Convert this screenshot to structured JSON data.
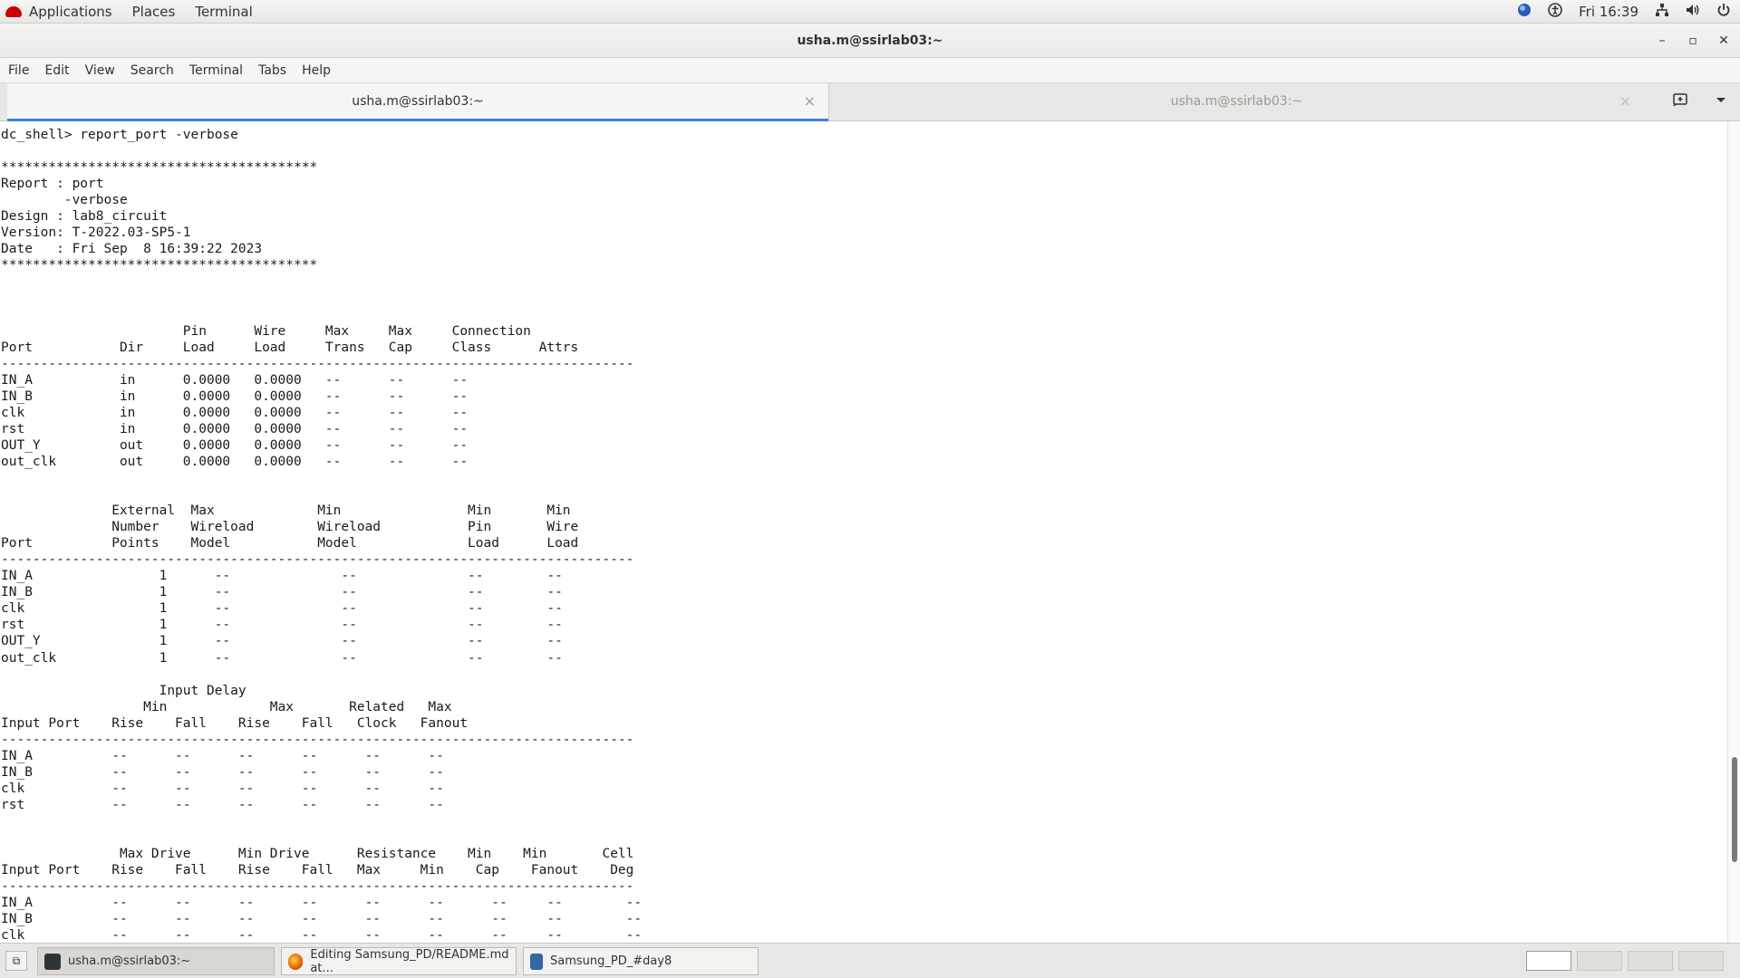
{
  "topbar": {
    "applications": "Applications",
    "places": "Places",
    "terminal": "Terminal",
    "clock": "Fri 16:39",
    "status_icons": [
      "globe-icon",
      "accessibility-icon",
      "network-icon",
      "volume-icon",
      "power-icon"
    ]
  },
  "window": {
    "title": "usha.m@ssirlab03:~",
    "minimize": "–",
    "maximize": "▫",
    "close": "✕"
  },
  "menubar": [
    "File",
    "Edit",
    "View",
    "Search",
    "Terminal",
    "Tabs",
    "Help"
  ],
  "tabs": [
    {
      "label": "usha.m@ssirlab03:~",
      "active": true,
      "close": "×"
    },
    {
      "label": "usha.m@ssirlab03:~",
      "active": false,
      "close": "×"
    }
  ],
  "terminal": {
    "lines": [
      "dc_shell> report_port -verbose",
      "",
      "****************************************",
      "Report : port",
      "        -verbose",
      "Design : lab8_circuit",
      "Version: T-2022.03-SP5-1",
      "Date   : Fri Sep  8 16:39:22 2023",
      "****************************************",
      "",
      "",
      "",
      "                       Pin      Wire     Max     Max     Connection",
      "Port           Dir     Load     Load     Trans   Cap     Class      Attrs",
      "--------------------------------------------------------------------------------",
      "IN_A           in      0.0000   0.0000   --      --      --",
      "IN_B           in      0.0000   0.0000   --      --      --",
      "clk            in      0.0000   0.0000   --      --      --",
      "rst            in      0.0000   0.0000   --      --      --",
      "OUT_Y          out     0.0000   0.0000   --      --      --",
      "out_clk        out     0.0000   0.0000   --      --      --",
      "",
      "",
      "              External  Max             Min                Min       Min",
      "              Number    Wireload        Wireload           Pin       Wire",
      "Port          Points    Model           Model              Load      Load",
      "--------------------------------------------------------------------------------",
      "IN_A                1      --              --              --        --",
      "IN_B                1      --              --              --        --",
      "clk                 1      --              --              --        --",
      "rst                 1      --              --              --        --",
      "OUT_Y               1      --              --              --        --",
      "out_clk             1      --              --              --        --",
      "",
      "                    Input Delay",
      "                  Min             Max       Related   Max",
      "Input Port    Rise    Fall    Rise    Fall   Clock   Fanout",
      "--------------------------------------------------------------------------------",
      "IN_A          --      --      --      --      --      --",
      "IN_B          --      --      --      --      --      --",
      "clk           --      --      --      --      --      --",
      "rst           --      --      --      --      --      --",
      "",
      "",
      "               Max Drive      Min Drive      Resistance    Min    Min       Cell",
      "Input Port    Rise    Fall    Rise    Fall   Max     Min    Cap    Fanout    Deg",
      "--------------------------------------------------------------------------------",
      "IN_A          --      --      --      --      --      --      --     --        --",
      "IN_B          --      --      --      --      --      --      --     --        --",
      "clk           --      --      --      --      --      --      --     --        --"
    ]
  },
  "taskbar": {
    "show_desktop": "⧉",
    "tasks": [
      {
        "label": "usha.m@ssirlab03:~",
        "icon": "terminal-icon",
        "active": true
      },
      {
        "label": "Editing Samsung_PD/README.md at...",
        "icon": "firefox-icon",
        "active": false
      },
      {
        "label": "Samsung_PD_#day8",
        "icon": "document-icon",
        "active": false
      }
    ],
    "workspaces": 4
  }
}
